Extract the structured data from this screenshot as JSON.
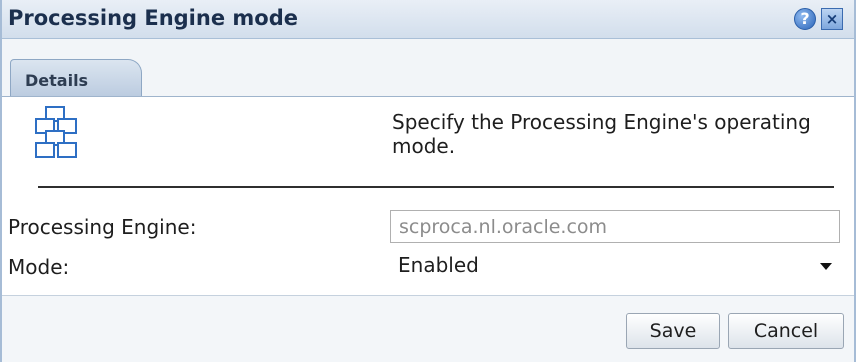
{
  "window": {
    "title": "Processing Engine mode",
    "help_glyph": "?",
    "close_glyph": "×"
  },
  "tabs": [
    {
      "label": "Details",
      "active": true
    }
  ],
  "main": {
    "icon": "processing-engine-icon",
    "description": "Specify the Processing Engine's operating mode."
  },
  "form": {
    "engine": {
      "label": "Processing Engine:",
      "value": "scproca.nl.oracle.com"
    },
    "mode": {
      "label": "Mode:",
      "selected": "Enabled"
    }
  },
  "footer": {
    "save_label": "Save",
    "cancel_label": "Cancel"
  },
  "colors": {
    "title_text": "#1b2f4d",
    "titlebar_bg": "#d2deec",
    "icon_blue": "#2e6fc4"
  }
}
